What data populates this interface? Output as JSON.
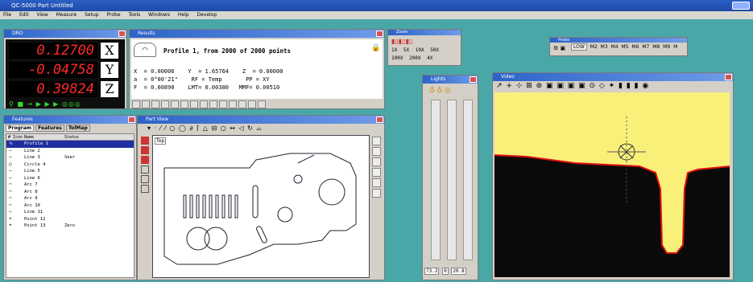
{
  "app": {
    "title": "QC-5000 Part Untitled"
  },
  "menu": [
    "File",
    "Edit",
    "View",
    "Measure",
    "Setup",
    "Probe",
    "Tools",
    "Windows",
    "Help",
    "Develop"
  ],
  "dro": {
    "title": "DRO",
    "x_value": "0.12700",
    "x_axis": "X",
    "y_value": "-0.04758",
    "y_axis": "Y",
    "z_value": "0.39824",
    "z_axis": "Z",
    "tools": "⚲ ■ → ▶ ▶ ▶ ◎◎◎"
  },
  "results": {
    "title": "Results",
    "heading": "Profile 1, from 2000 of 2000 points",
    "line1": "X  = 0.00006    Y  = 1.65764    Z  = 0.00000",
    "line2": "a  = 0°00'21\"    RF = Temp       PP = XY",
    "line3": "F  = 0.00890    LMT= 0.00380   MMF= 0.00510"
  },
  "features": {
    "title": "Features",
    "tabs": [
      "Program",
      "Features",
      "TolMap"
    ],
    "headers": [
      "#",
      "Icon",
      "Name",
      "Status"
    ],
    "rows": [
      {
        "icon": "∿",
        "name": "Profile 1",
        "status": "",
        "selected": true
      },
      {
        "icon": "—",
        "name": "Line 2",
        "status": ""
      },
      {
        "icon": "—",
        "name": "Line 3",
        "status": "Seer"
      },
      {
        "icon": "○",
        "name": "Circle 4",
        "status": ""
      },
      {
        "icon": "—",
        "name": "Line 5",
        "status": ""
      },
      {
        "icon": "—",
        "name": "Line 6",
        "status": ""
      },
      {
        "icon": "⌒",
        "name": "Arc 7",
        "status": ""
      },
      {
        "icon": "⌒",
        "name": "Arc 8",
        "status": ""
      },
      {
        "icon": "⌒",
        "name": "Arc 9",
        "status": ""
      },
      {
        "icon": "⌒",
        "name": "Arc 10",
        "status": ""
      },
      {
        "icon": "—",
        "name": "Line 11",
        "status": ""
      },
      {
        "icon": "•",
        "name": "Point 12",
        "status": ""
      },
      {
        "icon": "•",
        "name": "Point 13",
        "status": "Zero"
      }
    ]
  },
  "partview": {
    "title": "Part View",
    "top_label": "Top"
  },
  "zoom": {
    "title": "Zoom",
    "items": [
      "1X",
      "5X",
      "10X",
      "50X",
      "100X",
      "200X",
      "4X",
      "5X"
    ]
  },
  "lights": {
    "title": "Lights",
    "values": [
      "73.2",
      "0",
      "20.8"
    ]
  },
  "probe": {
    "title": "Probe",
    "items": [
      "LOW",
      "M2",
      "M3",
      "M4",
      "M5",
      "M6",
      "M7",
      "M8",
      "M9",
      "M"
    ]
  },
  "video": {
    "title": "Video",
    "bg_yellow": "#f9f07a",
    "bg_black": "#0a0a0a",
    "edge": "#e01010"
  }
}
